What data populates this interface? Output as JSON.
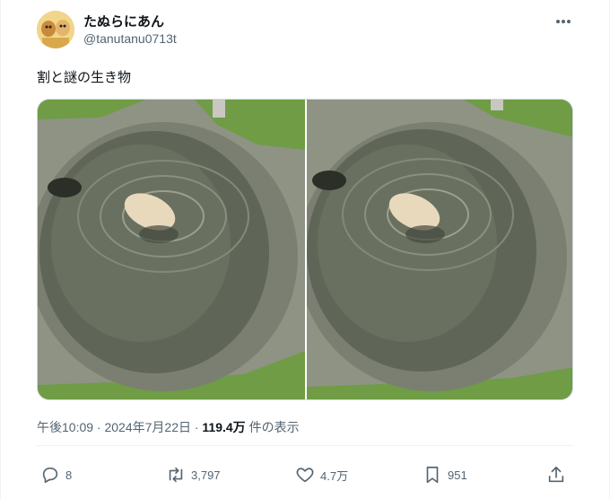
{
  "author": {
    "display_name": "たぬらにあん",
    "handle": "@tanutanu0713t"
  },
  "tweet": {
    "text": "割と謎の生き物",
    "media_count": 2
  },
  "meta": {
    "time_date": "午後10:09 · 2024年7月22日 · ",
    "views_count": "119.4万",
    "views_label": " 件の表示"
  },
  "actions": {
    "replies": "8",
    "retweets": "3,797",
    "likes": "4.7万",
    "bookmarks": "951"
  },
  "icons": {
    "more": "more-icon",
    "reply": "reply-icon",
    "retweet": "retweet-icon",
    "like": "heart-icon",
    "bookmark": "bookmark-icon",
    "share": "share-icon"
  },
  "colors": {
    "text": "#0f1419",
    "secondary": "#536471",
    "border": "#cfd9de"
  }
}
